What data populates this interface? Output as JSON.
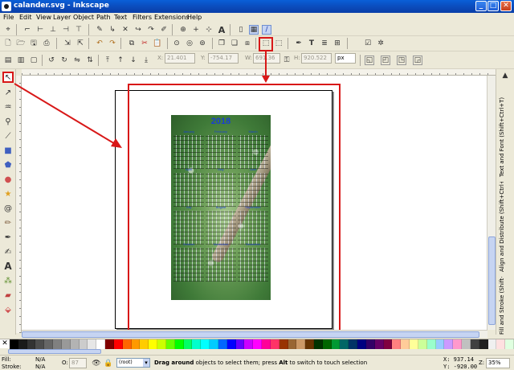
{
  "window": {
    "title": "calander.svg - Inkscape",
    "minimize": "_",
    "maximize": "□",
    "close": "✕"
  },
  "menu": [
    "File",
    "Edit",
    "View",
    "Layer",
    "Object",
    "Path",
    "Text",
    "Filters",
    "Extensions",
    "Help"
  ],
  "select_toolbar": {
    "x_label": "X:",
    "x_value": "21.401",
    "y_label": "Y:",
    "y_value": "-754.17",
    "w_label": "W:",
    "w_value": "691.36",
    "h_label": "H:",
    "h_value": "920.522",
    "unit": "px"
  },
  "calendar": {
    "year": "2018",
    "months": [
      "January",
      "February",
      "March",
      "April",
      "May",
      "June",
      "July",
      "August",
      "September",
      "October",
      "November",
      "December"
    ]
  },
  "dock_tabs": [
    "Text and Font (Shift+Ctrl+T)",
    "Align and Distribute (Shift+Ctrl+A)",
    "Fill and Stroke (Shift+Ctrl+F)"
  ],
  "palette_colors": [
    "#000000",
    "#1a1a1a",
    "#333333",
    "#4d4d4d",
    "#666666",
    "#808080",
    "#999999",
    "#b3b3b3",
    "#cccccc",
    "#e6e6e6",
    "#ffffff",
    "#800000",
    "#ff0000",
    "#ff6600",
    "#ff9900",
    "#ffcc00",
    "#ffff00",
    "#ccff00",
    "#66ff00",
    "#00ff00",
    "#00ff66",
    "#00ffcc",
    "#00ffff",
    "#00ccff",
    "#0066ff",
    "#0000ff",
    "#6600ff",
    "#cc00ff",
    "#ff00ff",
    "#ff0099",
    "#ff3366",
    "#993300",
    "#996633",
    "#cc9966",
    "#663300",
    "#003300",
    "#006600",
    "#009933",
    "#006666",
    "#003366",
    "#000080",
    "#330066",
    "#660066",
    "#800040",
    "#ff8080",
    "#ffcc99",
    "#ffff99",
    "#ccff99",
    "#99ffcc",
    "#99ccff",
    "#cc99ff",
    "#ff99cc",
    "#c0c0c0",
    "#404040",
    "#202020",
    "#f0f0f0",
    "#ffe0e0",
    "#e0ffe0"
  ],
  "status": {
    "fill_label": "Fill:",
    "fill_value": "N/A",
    "stroke_label": "Stroke:",
    "stroke_value": "N/A",
    "opacity_label": "O:",
    "opacity_value": "87",
    "layer": "(root)",
    "msg_bold1": "Drag around",
    "msg1": " objects to select them; press ",
    "msg_bold2": "Alt",
    "msg2": " to switch to touch selection",
    "x_coord": "X:  937.14",
    "y_coord": "Y: -920.00",
    "zoom_label": "Z:",
    "zoom_value": "35%"
  }
}
